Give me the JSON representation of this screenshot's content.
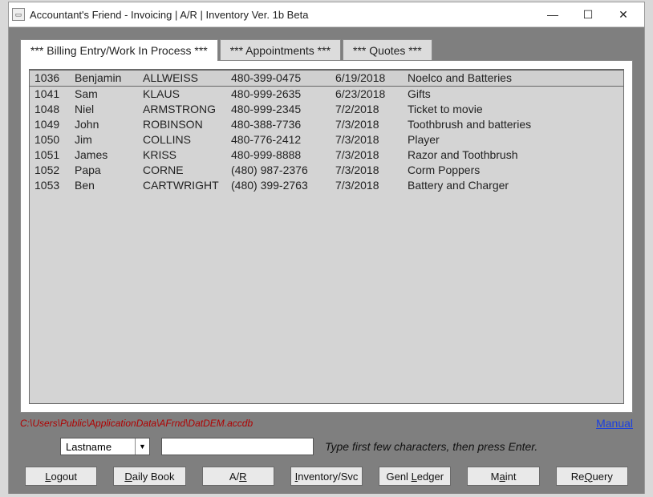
{
  "window": {
    "title": "Accountant's Friend - Invoicing | A/R | Inventory Ver. 1b Beta"
  },
  "tabs": [
    {
      "label": "*** Billing Entry/Work In Process ***",
      "active": true
    },
    {
      "label": "*** Appointments ***",
      "active": false
    },
    {
      "label": "*** Quotes ***",
      "active": false
    }
  ],
  "grid": {
    "rows": [
      {
        "id": "1036",
        "first": "Benjamin",
        "last": "ALLWEISS",
        "phone": "480-399-0475",
        "date": "6/19/2018",
        "desc": "Noelco and Batteries"
      },
      {
        "id": "1041",
        "first": "Sam",
        "last": "KLAUS",
        "phone": "480-999-2635",
        "date": "6/23/2018",
        "desc": "Gifts"
      },
      {
        "id": "1048",
        "first": "Niel",
        "last": "ARMSTRONG",
        "phone": "480-999-2345",
        "date": "7/2/2018",
        "desc": "Ticket to movie"
      },
      {
        "id": "1049",
        "first": "John",
        "last": "ROBINSON",
        "phone": "480-388-7736",
        "date": "7/3/2018",
        "desc": "Toothbrush and batteries"
      },
      {
        "id": "1050",
        "first": "Jim",
        "last": "COLLINS",
        "phone": "480-776-2412",
        "date": "7/3/2018",
        "desc": "Player"
      },
      {
        "id": "1051",
        "first": "James",
        "last": "KRISS",
        "phone": "480-999-8888",
        "date": "7/3/2018",
        "desc": "Razor and Toothbrush"
      },
      {
        "id": "1052",
        "first": "Papa",
        "last": "CORNE",
        "phone": "(480) 987-2376",
        "date": "7/3/2018",
        "desc": "Corm Poppers"
      },
      {
        "id": "1053",
        "first": "Ben",
        "last": "CARTWRIGHT",
        "phone": "(480) 399-2763",
        "date": "7/3/2018",
        "desc": "Battery and Charger"
      }
    ]
  },
  "path": "C:\\Users\\Public\\ApplicationData\\AFrnd\\DatDEM.accdb",
  "manual_link": "Manual",
  "search": {
    "field": "Lastname",
    "value": "",
    "hint": "Type first few characters, then press Enter."
  },
  "buttons": {
    "logout": {
      "pre": "",
      "u": "L",
      "post": "ogout"
    },
    "dailybook": {
      "pre": "",
      "u": "D",
      "post": "aily Book"
    },
    "ar": {
      "pre": "A/",
      "u": "R",
      "post": ""
    },
    "inventory": {
      "pre": "",
      "u": "I",
      "post": "nventory/Svc"
    },
    "genl": {
      "pre": "Genl ",
      "u": "L",
      "post": "edger"
    },
    "maint": {
      "pre": "M",
      "u": "a",
      "post": "int"
    },
    "requery": {
      "pre": "Re",
      "u": "Q",
      "post": "uery"
    }
  }
}
